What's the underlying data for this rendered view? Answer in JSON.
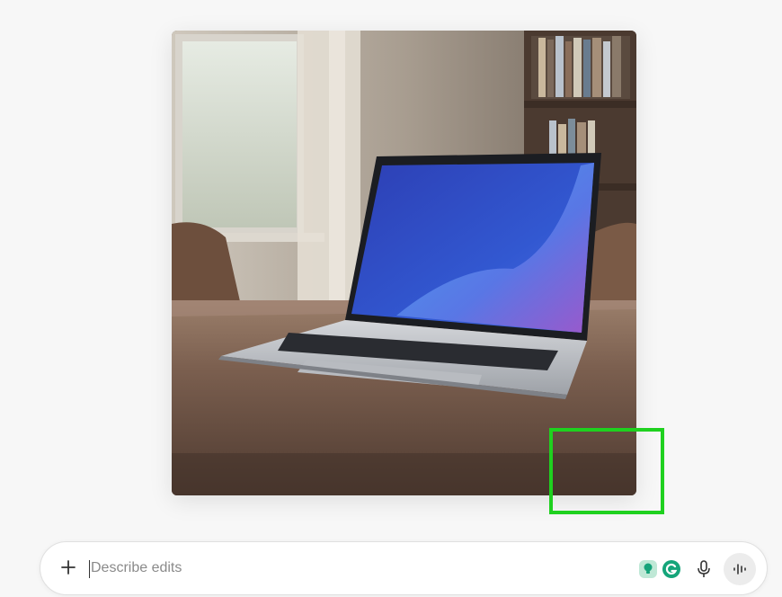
{
  "composer": {
    "placeholder": "Describe edits",
    "icons": {
      "add": "plus-icon",
      "extension_1": "lightbulb-badge-icon",
      "extension_2": "grammarly-icon",
      "mic": "microphone-icon",
      "voice": "voice-mode-icon"
    }
  },
  "image": {
    "subject_icon": "generated-image"
  },
  "colors": {
    "selection_box": "#1fd11f",
    "extension_1_bg": "#16a37a",
    "extension_2_bg": "#15a57a"
  }
}
